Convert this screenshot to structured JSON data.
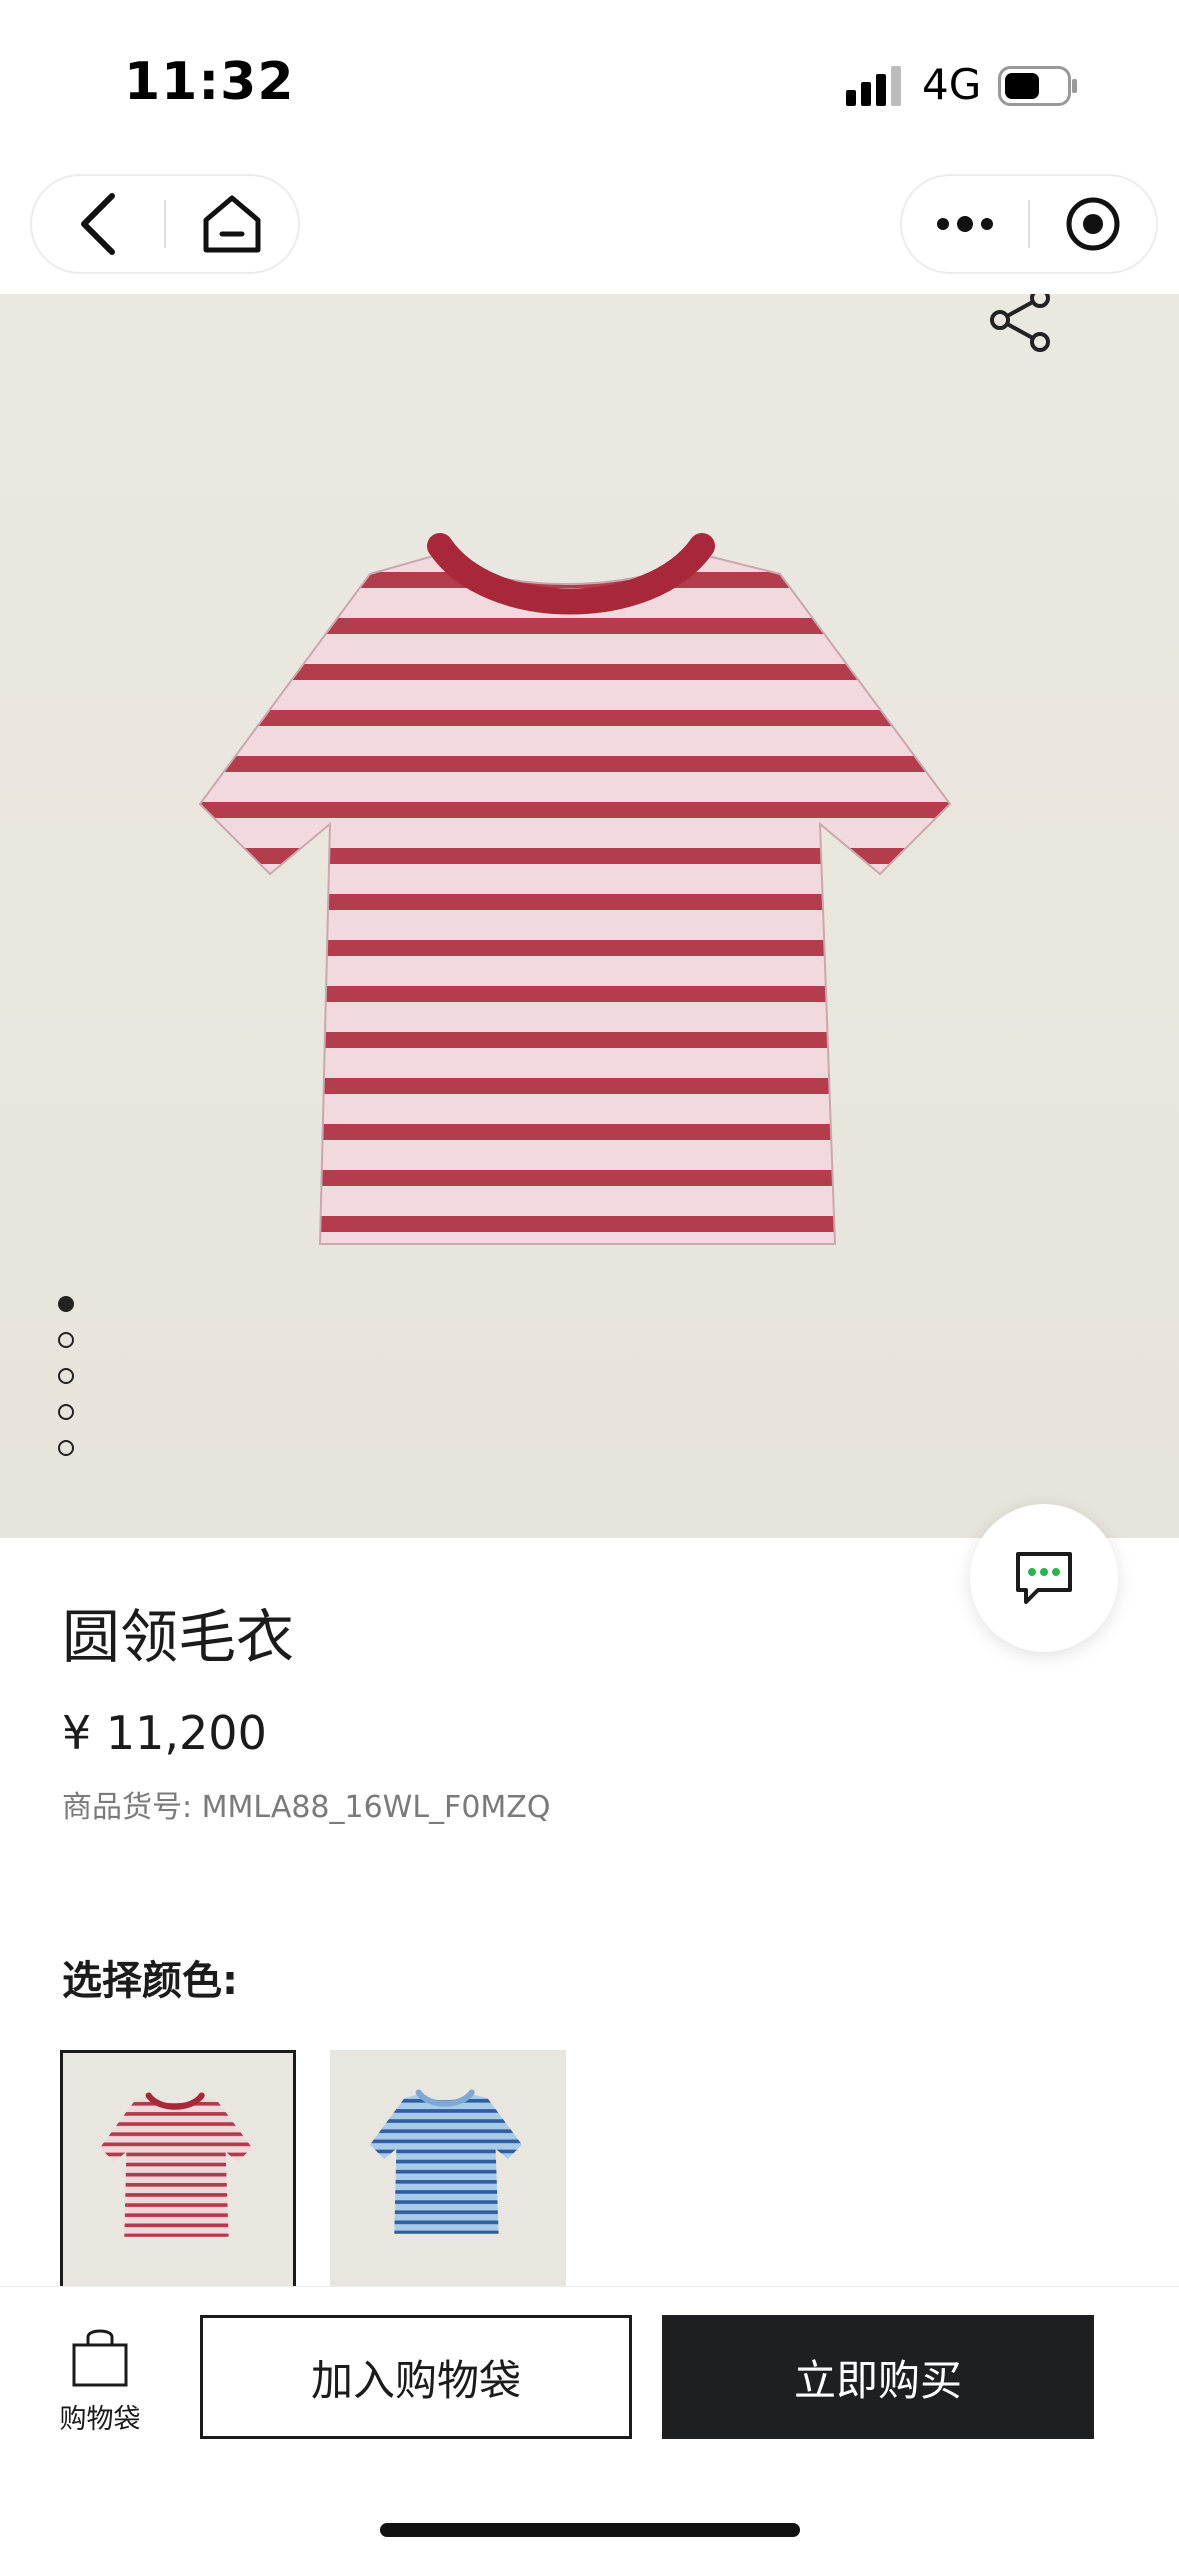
{
  "status_bar": {
    "time": "11:32",
    "network": "4G"
  },
  "nav": {
    "back_icon": "chevron-left-icon",
    "home_icon": "home-icon",
    "more_icon": "more-dots-icon",
    "close_icon": "target-close-icon"
  },
  "hero": {
    "share_icon": "share-icon",
    "carousel_count": 5,
    "carousel_active_index": 0
  },
  "product": {
    "title": "圆领毛衣",
    "price": "¥ 11,200",
    "sku": "商品货号: MMLA88_16WL_F0MZQ"
  },
  "colors": {
    "label": "选择颜色:",
    "options": [
      {
        "name": "red-stripe",
        "stripe": "#b03a4a",
        "base": "#f1d7dc",
        "selected": true
      },
      {
        "name": "blue-stripe",
        "stripe": "#2f5d9e",
        "base": "#a9cbea",
        "selected": false
      }
    ]
  },
  "bottom_bar": {
    "bag_label": "购物袋",
    "add_to_bag": "加入购物袋",
    "buy_now": "立即购买"
  },
  "theme": {
    "dark": "#1d1f20",
    "hero_bg": "#ebe8e1",
    "collar": "#a8283a"
  }
}
